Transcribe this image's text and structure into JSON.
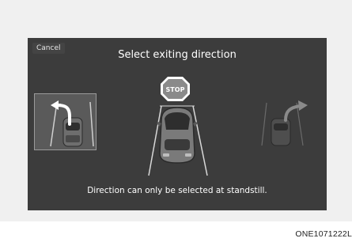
{
  "dialog": {
    "cancel_label": "Cancel",
    "title": "Select exiting direction",
    "message": "Direction can only be selected at standstill."
  },
  "center": {
    "stop_sign_text": "STOP",
    "icons": [
      "stop-sign-icon",
      "car-front-icon"
    ]
  },
  "options": {
    "left": {
      "icon": "curved-arrow-left-icon",
      "state": "highlighted"
    },
    "right": {
      "icon": "curved-arrow-right-icon",
      "state": "dimmed"
    }
  },
  "caption": "ONE1071222L",
  "colors": {
    "screen_bg": "#3c3c3c",
    "panel_bg": "#f0f0f0",
    "stop_red": "#cfcfcf",
    "text": "#ffffff"
  }
}
